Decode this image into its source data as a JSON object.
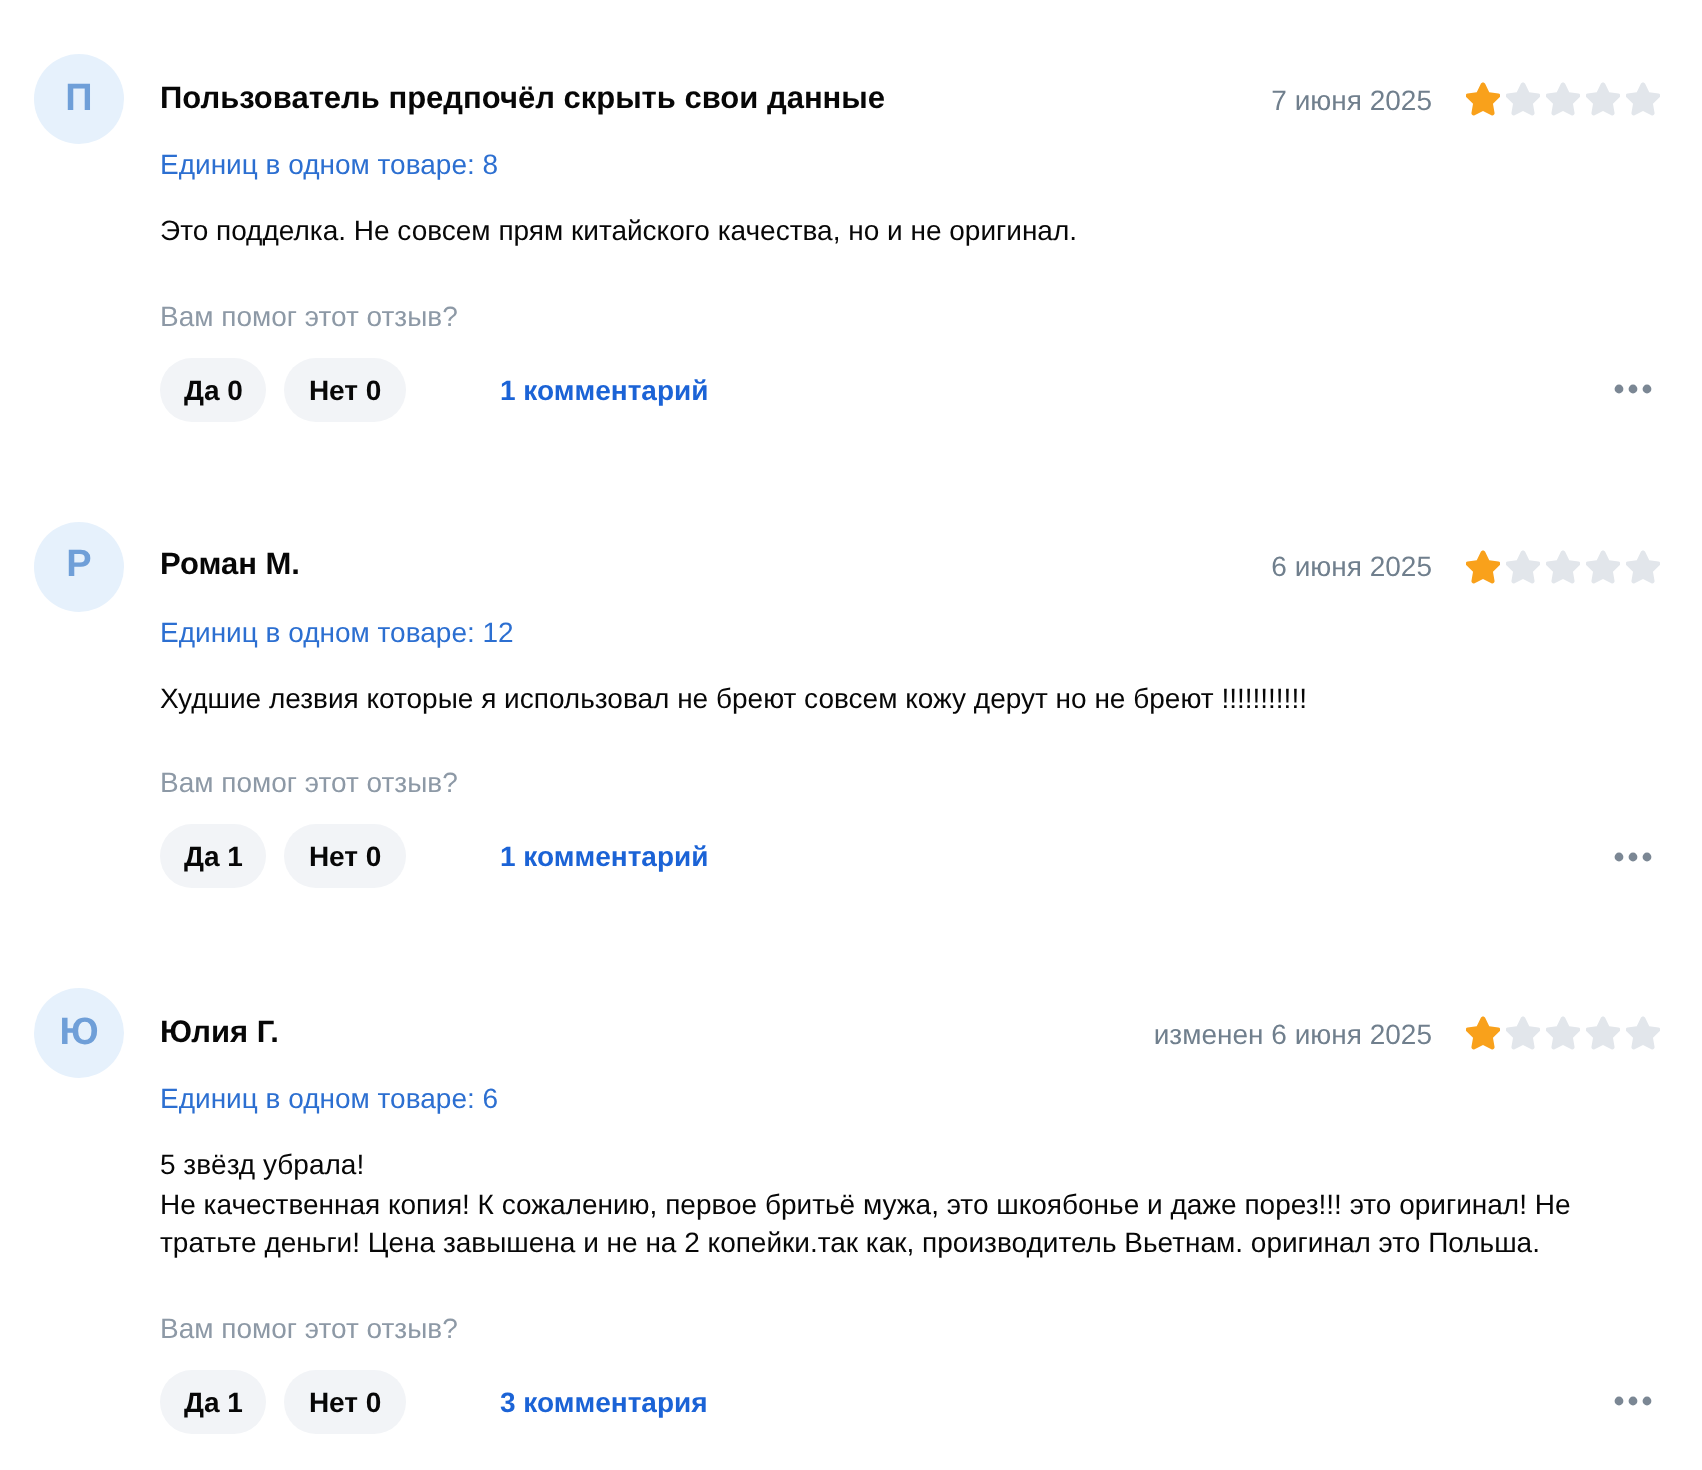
{
  "reviews": [
    {
      "avatar_letter": "П",
      "author": "Пользователь предпочёл скрыть свои данные",
      "date": "7 июня 2025",
      "stars": 1,
      "units": "Единиц в одном товаре: 8",
      "text": "Это подделка. Не совсем прям китайского качества, но и не оригинал.",
      "question": "Вам помог этот отзыв?",
      "yes_button": "Да 0",
      "no_button": "Нет 0",
      "comments_link": "1 комментарий"
    },
    {
      "avatar_letter": "Р",
      "author": "Роман М.",
      "date": "6 июня 2025",
      "stars": 1,
      "units": "Единиц в одном товаре: 12",
      "text": "Худшие лезвия которые я использовал не бреют совсем кожу дерут но не бреют !!!!!!!!!!!",
      "question": "Вам помог этот отзыв?",
      "yes_button": "Да 1",
      "no_button": "Нет 0",
      "comments_link": "1 комментарий"
    },
    {
      "avatar_letter": "Ю",
      "author": "Юлия Г.",
      "date": "изменен 6 июня 2025",
      "stars": 1,
      "units": "Единиц в одном товаре: 6",
      "text": "5 звёзд убрала!\nНе качественная копия! К сожалению, первое бритьё мужа, это шкоябонье и даже порез!!! это оригинал! Не тратьте деньги! Цена завышена и не на 2 копейки.так как, производитель Вьетнам. оригинал это Польша.",
      "question": "Вам помог этот отзыв?",
      "yes_button": "Да 1",
      "no_button": "Нет 0",
      "comments_link": "3 комментария"
    }
  ]
}
